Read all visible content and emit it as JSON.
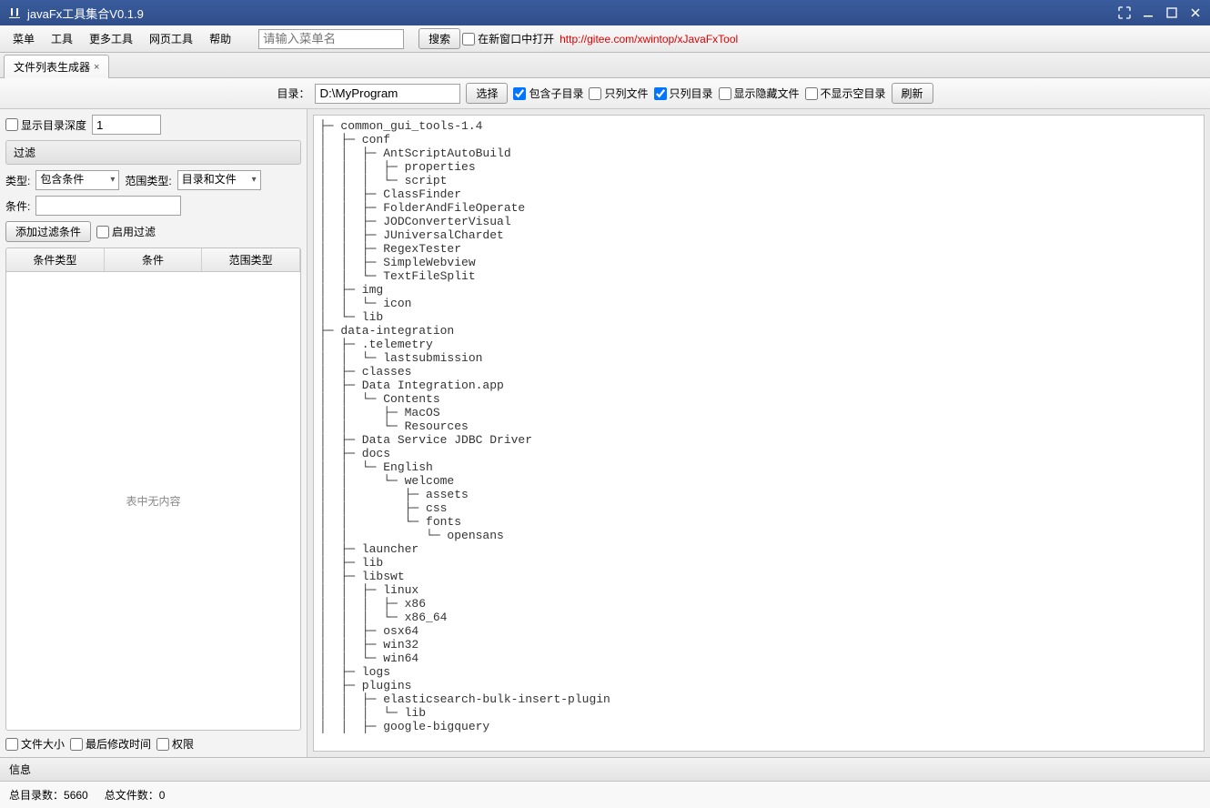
{
  "window": {
    "title": "javaFx工具集合V0.1.9"
  },
  "menubar": {
    "items": [
      "菜单",
      "工具",
      "更多工具",
      "网页工具",
      "帮助"
    ],
    "search_placeholder": "请输入菜单名",
    "search_btn": "搜索",
    "open_in_new_label": "在新窗口中打开",
    "link_text": "http://gitee.com/xwintop/xJavaFxTool"
  },
  "tab": {
    "label": "文件列表生成器",
    "close": "×"
  },
  "toolbar": {
    "dir_label": "目录：",
    "dir_value": "D:\\MyProgram",
    "select_btn": "选择",
    "include_sub": "包含子目录",
    "only_files": "只列文件",
    "only_dirs": "只列目录",
    "show_hidden": "显示隐藏文件",
    "hide_empty": "不显示空目录",
    "refresh_btn": "刷新"
  },
  "sidebar": {
    "show_depth_label": "显示目录深度",
    "depth_value": "1",
    "filter_header": "过滤",
    "type_label": "类型:",
    "type_value": "包含条件",
    "scope_type_label": "范围类型:",
    "scope_type_value": "目录和文件",
    "condition_label": "条件:",
    "add_filter_btn": "添加过滤条件",
    "enable_filter_label": "启用过滤",
    "table_headers": [
      "条件类型",
      "条件",
      "范围类型"
    ],
    "table_empty": "表中无内容",
    "file_size_label": "文件大小",
    "last_modified_label": "最后修改时间",
    "permission_label": "权限"
  },
  "tree_lines": [
    "├─ common_gui_tools-1.4",
    "│  ├─ conf",
    "│  │  ├─ AntScriptAutoBuild",
    "│  │  │  ├─ properties",
    "│  │  │  └─ script",
    "│  │  ├─ ClassFinder",
    "│  │  ├─ FolderAndFileOperate",
    "│  │  ├─ JODConverterVisual",
    "│  │  ├─ JUniversalChardet",
    "│  │  ├─ RegexTester",
    "│  │  ├─ SimpleWebview",
    "│  │  └─ TextFileSplit",
    "│  ├─ img",
    "│  │  └─ icon",
    "│  └─ lib",
    "├─ data-integration",
    "│  ├─ .telemetry",
    "│  │  └─ lastsubmission",
    "│  ├─ classes",
    "│  ├─ Data Integration.app",
    "│  │  └─ Contents",
    "│  │     ├─ MacOS",
    "│  │     └─ Resources",
    "│  ├─ Data Service JDBC Driver",
    "│  ├─ docs",
    "│  │  └─ English",
    "│  │     └─ welcome",
    "│  │        ├─ assets",
    "│  │        ├─ css",
    "│  │        └─ fonts",
    "│  │           └─ opensans",
    "│  ├─ launcher",
    "│  ├─ lib",
    "│  ├─ libswt",
    "│  │  ├─ linux",
    "│  │  │  ├─ x86",
    "│  │  │  └─ x86_64",
    "│  │  ├─ osx64",
    "│  │  ├─ win32",
    "│  │  └─ win64",
    "│  ├─ logs",
    "│  ├─ plugins",
    "│  │  ├─ elasticsearch-bulk-insert-plugin",
    "│  │  │  └─ lib",
    "│  │  ├─ google-bigquery"
  ],
  "info": {
    "header": "信息",
    "total_dir_label": "总目录数：",
    "total_dir_value": "5660",
    "total_file_label": "总文件数：",
    "total_file_value": "0"
  }
}
